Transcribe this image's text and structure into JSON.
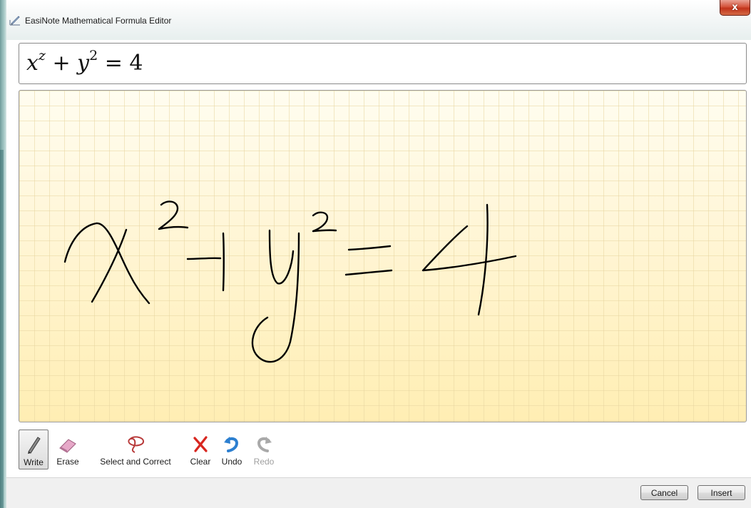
{
  "window": {
    "title": "EasiNote Mathematical Formula Editor",
    "close_label": "x"
  },
  "formula": {
    "base1": "x",
    "exp1": "z",
    "plus": " + ",
    "base2": "y",
    "exp2": "2",
    "rest": " = 4"
  },
  "canvas": {
    "background_color": "#fff3cc",
    "grid_color": "#e8d6a0",
    "ink_color": "#000000"
  },
  "toolbar": {
    "write_label": "Write",
    "erase_label": "Erase",
    "select_label": "Select and Correct",
    "clear_label": "Clear",
    "undo_label": "Undo",
    "redo_label": "Redo",
    "active_tool": "Write"
  },
  "buttons": {
    "cancel_label": "Cancel",
    "insert_label": "Insert"
  },
  "icons": [
    "app-icon",
    "pen-icon",
    "eraser-icon",
    "lasso-icon",
    "clear-x-icon",
    "undo-icon",
    "redo-icon"
  ]
}
